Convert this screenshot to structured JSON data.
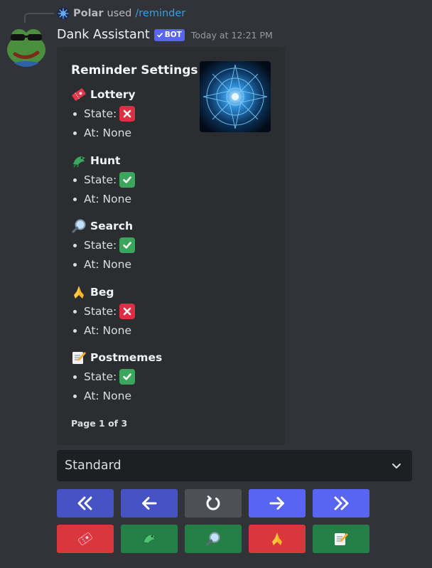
{
  "reply": {
    "username": "Polar",
    "used_text": "used",
    "command": "/reminder"
  },
  "message": {
    "author": "Dank Assistant",
    "bot_tag": "BOT",
    "timestamp": "Today at 12:21 PM"
  },
  "embed": {
    "title": "Reminder Settings",
    "sections": [
      {
        "name": "Lottery",
        "icon": "ticket-icon",
        "state_label": "State:",
        "state": "off",
        "at_text": "At: None"
      },
      {
        "name": "Hunt",
        "icon": "dragon-icon",
        "state_label": "State:",
        "state": "on",
        "at_text": "At: None"
      },
      {
        "name": "Search",
        "icon": "magnifier-icon",
        "state_label": "State:",
        "state": "on",
        "at_text": "At: None"
      },
      {
        "name": "Beg",
        "icon": "praying-hands-icon",
        "state_label": "State:",
        "state": "off",
        "at_text": "At: None"
      },
      {
        "name": "Postmemes",
        "icon": "memo-icon",
        "state_label": "State:",
        "state": "on",
        "at_text": "At: None"
      }
    ],
    "footer": "Page 1 of 3"
  },
  "select": {
    "value": "Standard"
  },
  "nav_buttons": [
    {
      "name": "first-page-button",
      "icon": "double-chevron-left-icon",
      "color": "#4752c4"
    },
    {
      "name": "prev-page-button",
      "icon": "arrow-left-icon",
      "color": "#4752c4"
    },
    {
      "name": "refresh-button",
      "icon": "refresh-icon",
      "color": "#4e5058"
    },
    {
      "name": "next-page-button",
      "icon": "arrow-right-icon",
      "color": "#5865f2"
    },
    {
      "name": "last-page-button",
      "icon": "double-chevron-right-icon",
      "color": "#5865f2"
    }
  ],
  "toggle_buttons": [
    {
      "name": "lottery-toggle-button",
      "icon": "ticket-icon",
      "color": "#da373c"
    },
    {
      "name": "hunt-toggle-button",
      "icon": "dragon-icon",
      "color": "#248046"
    },
    {
      "name": "search-toggle-button",
      "icon": "magnifier-icon",
      "color": "#248046"
    },
    {
      "name": "beg-toggle-button",
      "icon": "praying-hands-icon",
      "color": "#da373c"
    },
    {
      "name": "postmemes-toggle-button",
      "icon": "memo-icon",
      "color": "#248046"
    }
  ],
  "colors": {
    "background": "#313338",
    "embed": "#2b2d31",
    "blurple": "#5865f2",
    "green": "#248046",
    "red": "#da373c",
    "link": "#3a9fd9"
  }
}
